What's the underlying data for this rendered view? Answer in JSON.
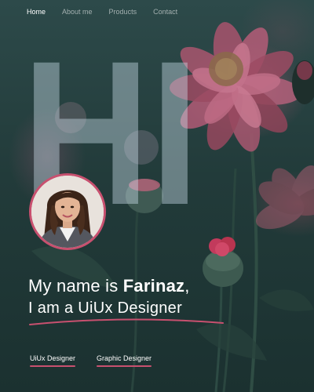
{
  "nav": {
    "items": [
      {
        "label": "Home",
        "active": true
      },
      {
        "label": "About me",
        "active": false
      },
      {
        "label": "Products",
        "active": false
      },
      {
        "label": "Contact",
        "active": false
      }
    ]
  },
  "hero": {
    "big_text": "HI",
    "intro_prefix": "My name is ",
    "name": "Farinaz",
    "intro_suffix": ",",
    "role_line": "I am a UiUx Designer",
    "avatar_icon": "profile-photo"
  },
  "tags": [
    {
      "label": "UiUx Designer"
    },
    {
      "label": "Graphic Designer"
    }
  ],
  "colors": {
    "accent": "#c8506f",
    "background": "#213a39",
    "text": "#ffffff",
    "nav_inactive": "rgba(255,255,255,0.55)"
  }
}
